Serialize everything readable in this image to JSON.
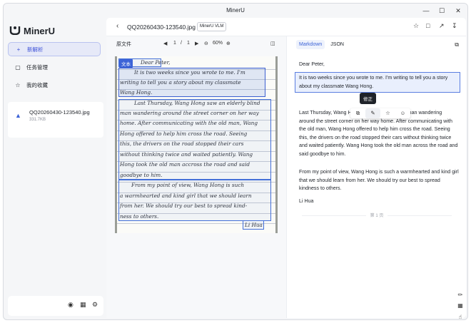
{
  "window": {
    "title": "MinerU",
    "controls": [
      "—",
      "☐",
      "✕"
    ]
  },
  "sidebar": {
    "app_name": "MinerU",
    "nav": [
      {
        "label": "新解析",
        "icon": "plus-icon"
      },
      {
        "label": "任务管理",
        "icon": "document-icon"
      },
      {
        "label": "我的收藏",
        "icon": "star-icon"
      }
    ],
    "file": {
      "name": "QQ20260430-123540.jpg",
      "size": "331.7KB"
    },
    "footer_icons": [
      "github-icon",
      "qr-icon",
      "settings-icon"
    ]
  },
  "toolbar": {
    "doc_name": "QQ20260430-123540.jpg",
    "model_badge": "MinerU VLM",
    "icons": [
      "star-icon",
      "folder-icon",
      "share-icon",
      "download-icon"
    ]
  },
  "viewer": {
    "label": "原文件",
    "page_current": "1",
    "page_sep": "/",
    "page_total": "1",
    "zoom": "60%",
    "tag_label": "文本",
    "lines": [
      "Dear   Peter,",
      "It is two weeks since you wrote to me. I'm",
      "writing to tell you a story about my classmate",
      "Wang Hong.",
      "Last Thursday, Wang Hong saw an elderly blind",
      "man wandering around the street corner on her way",
      "home. After communicating with the old man, Wang",
      "Hong offered to help him cross the road. Seeing",
      "this, the drivers on the road stopped their cars",
      "without thinking twice and waited patiently. Wang",
      "Hong took the old man accross the road and said",
      "goodbye to him.",
      "From my point of view, Wang Hong is such",
      "a warmhearted and kind girl that we should learn",
      "from her. We should try our best to spread kind-",
      "ness to others.",
      "Li Hua"
    ]
  },
  "result": {
    "tabs": [
      "Markdown",
      "JSON"
    ],
    "greeting": "Dear Peter,",
    "p1": "It is two weeks since you wrote to me. I'm writing to tell you a story about my classmate Wang Hong.",
    "p2": "Last Thursday, Wang Hong saw an elderly blind man wandering around the street corner on her way home. After communicating with the old man, Wang Hong offered to help him cross the road. Seeing this, the drivers on the road stopped their cars without thinking twice and waited patiently. Wang Hong took the old man across the road and said goodbye to him.",
    "p3": "From my point of view, Wang Hong is such a warmhearted and kind girl that we should learn from her. We should try our best to spread kindness to others.",
    "signature": "Li Hua",
    "page_marker": "第 1 页",
    "tooltip": "修正",
    "float_icons": [
      "copy-icon",
      "edit-icon",
      "star-icon",
      "more-icon"
    ]
  },
  "colors": {
    "accent": "#3c63d7",
    "selection_bg": "#e9effd",
    "sidebar_bg": "#f5f6f8"
  }
}
